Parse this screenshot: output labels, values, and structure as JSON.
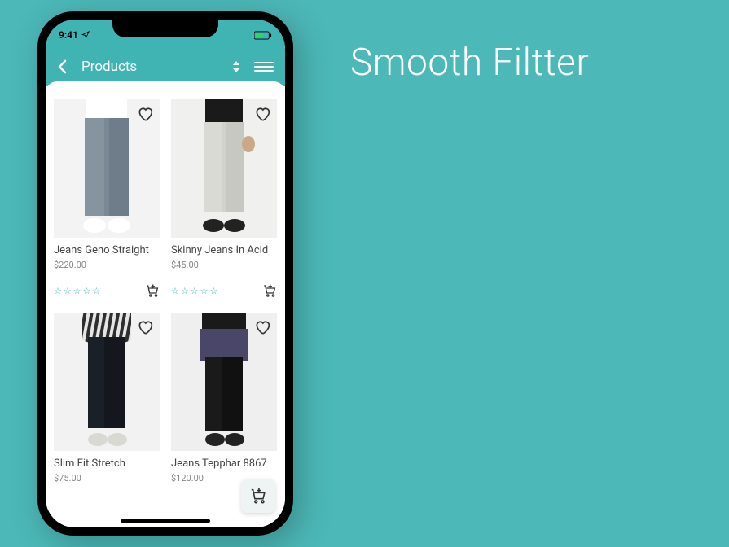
{
  "headline": "Smooth Filtter",
  "statusbar": {
    "time": "9:41"
  },
  "navbar": {
    "title": "Products"
  },
  "colors": {
    "accent": "#40b3b3"
  },
  "products": [
    {
      "name": "Jeans Geno Straight",
      "price": "$220.00",
      "rating": 0
    },
    {
      "name": "Skinny Jeans In Acid",
      "price": "$45.00",
      "rating": 0
    },
    {
      "name": "Slim Fit Stretch",
      "price": "$75.00",
      "rating": 0
    },
    {
      "name": "Jeans Tepphar 8867",
      "price": "$120.00",
      "rating": 0
    }
  ]
}
